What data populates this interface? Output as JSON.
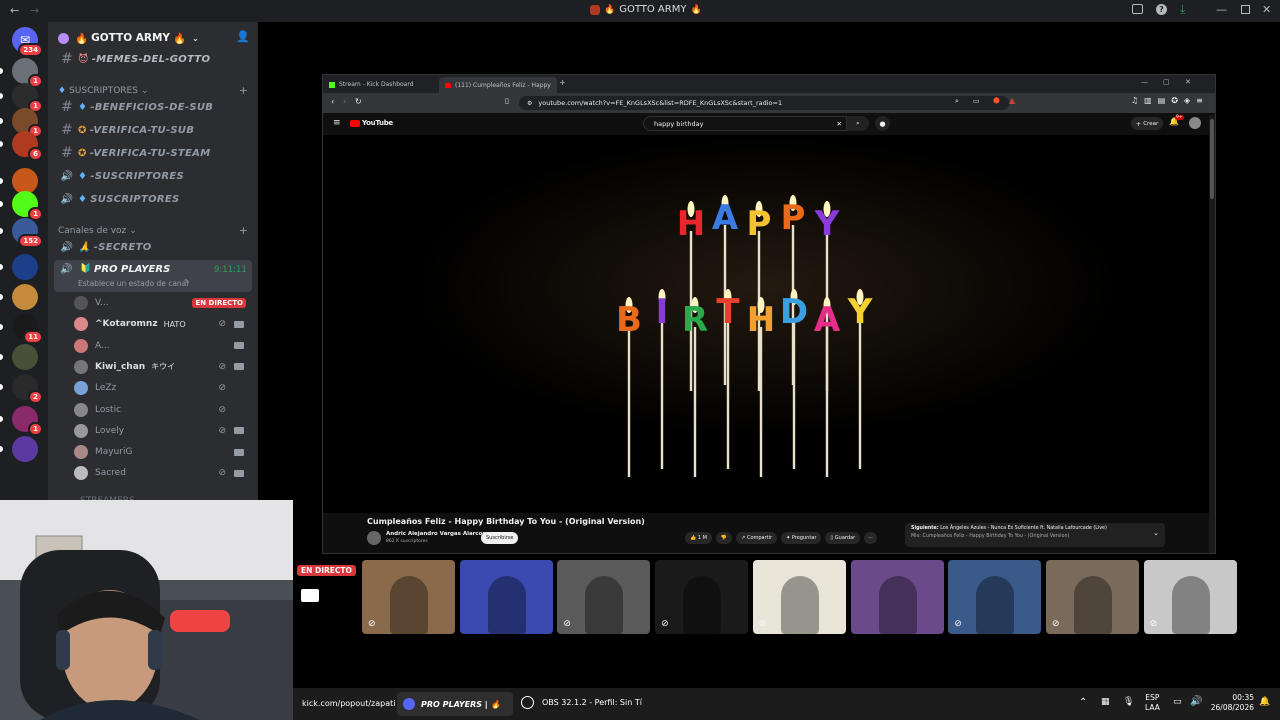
{
  "window": {
    "title": "GOTTO ARMY",
    "title_emoji": "🔥"
  },
  "rail": {
    "dm_badge": "234",
    "servers": [
      {
        "color": "#6b6f76",
        "badge": "1"
      },
      {
        "color": "#2c2c2c",
        "badge": "1"
      },
      {
        "color": "#7a4a2a",
        "badge": "1"
      },
      {
        "color": "#b03a1f",
        "badge": "6"
      },
      {
        "color": "#c8581a",
        "badge": ""
      },
      {
        "color": "#53fc18",
        "badge": "1"
      },
      {
        "color": "#3a5a9a",
        "badge": "152"
      },
      {
        "color": "#1d3f8a",
        "badge": ""
      },
      {
        "color": "#c58a3a",
        "badge": ""
      },
      {
        "color": "#1a1a1a",
        "badge": "11"
      },
      {
        "color": "#4a4f3a",
        "badge": ""
      },
      {
        "color": "#2a2a2a",
        "badge": "2"
      },
      {
        "color": "#8a2a6a",
        "badge": "1"
      },
      {
        "color": "#5a3aa0",
        "badge": ""
      }
    ]
  },
  "sidebar": {
    "server_name": "GOTTO ARMY",
    "top_channel": "-MEMES-DEL-GOTTO",
    "category_subs": "SUSCRIPTORES",
    "text_channels": [
      {
        "icon": "#",
        "label": "-BENEFICIOS-DE-SUB"
      },
      {
        "icon": "#",
        "label": "-VERIFICA-TU-SUB"
      },
      {
        "icon": "#",
        "label": "-VERIFICA-TU-STEAM"
      },
      {
        "icon": "🔊",
        "label": "-SUSCRIPTORES"
      },
      {
        "icon": "🔊",
        "label": "SUSCRIPTORES"
      }
    ],
    "category_voice": "Canales de voz",
    "voice_secret": "-SECRETO",
    "active_voice": {
      "label": "PRO PLAYERS",
      "timer": "9:11:11",
      "status": "Establece un estado de canal"
    },
    "live_label": "EN DIRECTO",
    "voice_users": [
      {
        "name": "V...",
        "color": "#555",
        "tag": ""
      },
      {
        "name": "^Kotaromnz",
        "color": "#d88",
        "tag": "HATO"
      },
      {
        "name": "A...",
        "color": "#c77",
        "tag": ""
      },
      {
        "name": "Kiwi_chan",
        "color": "#777",
        "tag": "キウイ"
      },
      {
        "name": "LeZz",
        "color": "#7aa0d8",
        "tag": ""
      },
      {
        "name": "Lostic",
        "color": "#888",
        "tag": ""
      },
      {
        "name": "Lovely",
        "color": "#999",
        "tag": ""
      },
      {
        "name": "MayuriG",
        "color": "#a88",
        "tag": ""
      },
      {
        "name": "Sacred",
        "color": "#bbb",
        "tag": ""
      }
    ],
    "next_category": "STREAMERS"
  },
  "browser": {
    "tabs": [
      {
        "label": "Stream - Kick Dashboard"
      },
      {
        "label": "(111) Cumpleaños Feliz - Happy"
      }
    ],
    "url": "youtube.com/watch?v=FE_KnGLsXSc&list=RDFE_KnGLsXSc&start_radio=1",
    "yt_logo": "YouTube",
    "search_value": "happy birthday",
    "create_label": "Crear",
    "notif_badge": "9+",
    "video_title": "Cumpleaños Feliz - Happy Birthday To You - (Original Version)",
    "channel_name": "Andric Alejandro Vargas Alarcon",
    "channel_subs": "862 K suscriptores",
    "subscribe_label": "Suscribirse",
    "likes": "1 M",
    "share_label": "Compartir",
    "ask_label": "Preguntar",
    "save_label": "Guardar",
    "next_label": "Siguiente:",
    "next_title": "Los Ángeles Azules - Nunca Es Suficiente ft. Natalia Lafourcade (Live)",
    "mix_label": "Mix: Cumpleaños Feliz - Happy Birthday To You - (Original Version)"
  },
  "strip": {
    "live_label": "EN DIRECTO",
    "tiles": [
      {
        "color": "#8a6a4a"
      },
      {
        "color": "#3a4ab0"
      },
      {
        "color": "#5a5a5a"
      },
      {
        "color": "#1a1a1a"
      },
      {
        "color": "#e8e4d8"
      },
      {
        "color": "#6a4a8a"
      },
      {
        "color": "#3a5a8a"
      },
      {
        "color": "#7a6a5a"
      },
      {
        "color": "#c8c8c8"
      }
    ]
  },
  "taskbar": {
    "item1": "kick.com/popout/zapati",
    "item2": "PRO PLAYERS | 🔥",
    "item3": "OBS 32.1.2 - Perfil: Sin Tí",
    "lang1": "ESP",
    "lang2": "LAA",
    "time": "00:35",
    "date": "26/08/2026"
  },
  "colors": {
    "discord_bg": "#2b2d31",
    "rail_bg": "#1e1f22",
    "live_red": "#da373c",
    "accent_green": "#23a55a",
    "yt_red": "#ff0000"
  }
}
